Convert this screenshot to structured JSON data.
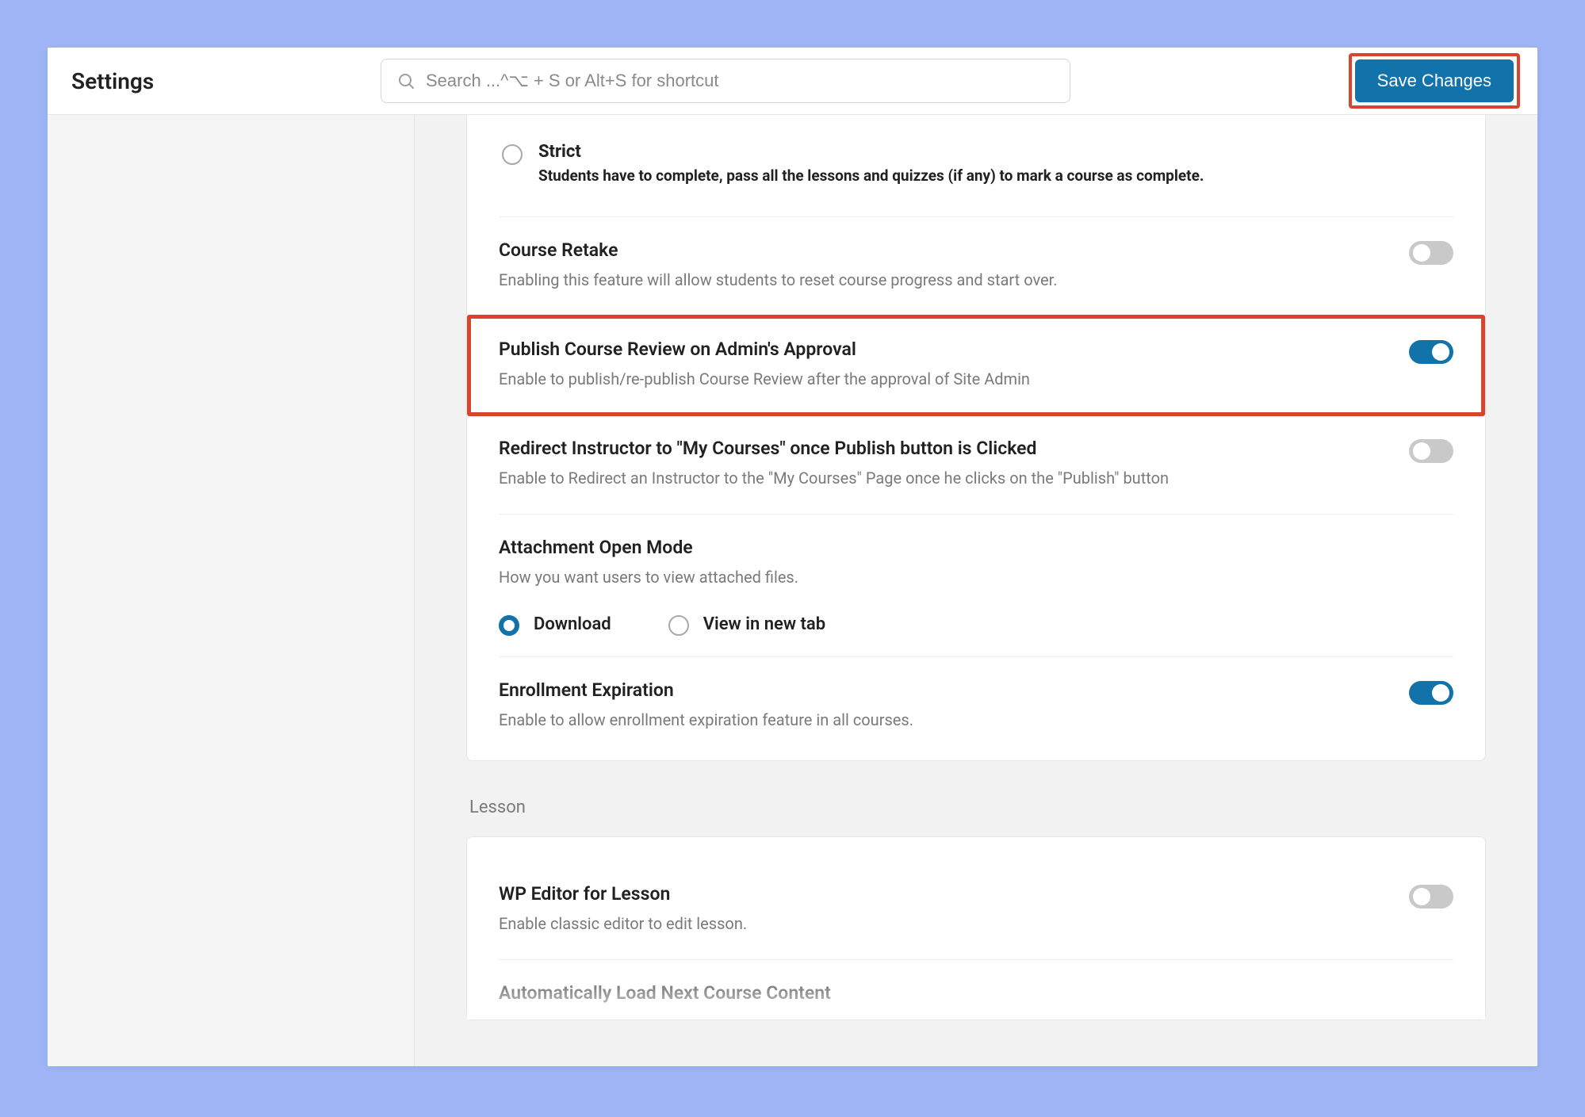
{
  "header": {
    "title": "Settings",
    "search_placeholder": "Search ...^⌥ + S or Alt+S for shortcut",
    "save_label": "Save Changes"
  },
  "course": {
    "strict": {
      "label": "Strict",
      "desc": "Students have to complete, pass all the lessons and quizzes (if any) to mark a course as complete.",
      "selected": false
    },
    "retake": {
      "title": "Course Retake",
      "desc": "Enabling this feature will allow students to reset course progress and start over.",
      "enabled": false
    },
    "publish_review": {
      "title": "Publish Course Review on Admin's Approval",
      "desc": "Enable to publish/re-publish Course Review after the approval of Site Admin",
      "enabled": true,
      "highlighted": true
    },
    "redirect_instructor": {
      "title": "Redirect Instructor to \"My Courses\" once Publish button is Clicked",
      "desc": "Enable to Redirect an Instructor to the \"My Courses\" Page once he clicks on the \"Publish\" button",
      "enabled": false
    },
    "attachment_mode": {
      "title": "Attachment Open Mode",
      "desc": "How you want users to view attached files.",
      "options": {
        "download": "Download",
        "new_tab": "View in new tab"
      },
      "selected": "download"
    },
    "enrollment_expiration": {
      "title": "Enrollment Expiration",
      "desc": "Enable to allow enrollment expiration feature in all courses.",
      "enabled": true
    }
  },
  "lesson": {
    "section_label": "Lesson",
    "wp_editor": {
      "title": "WP Editor for Lesson",
      "desc": "Enable classic editor to edit lesson.",
      "enabled": false
    },
    "auto_load_next": {
      "title": "Automatically Load Next Course Content"
    }
  }
}
